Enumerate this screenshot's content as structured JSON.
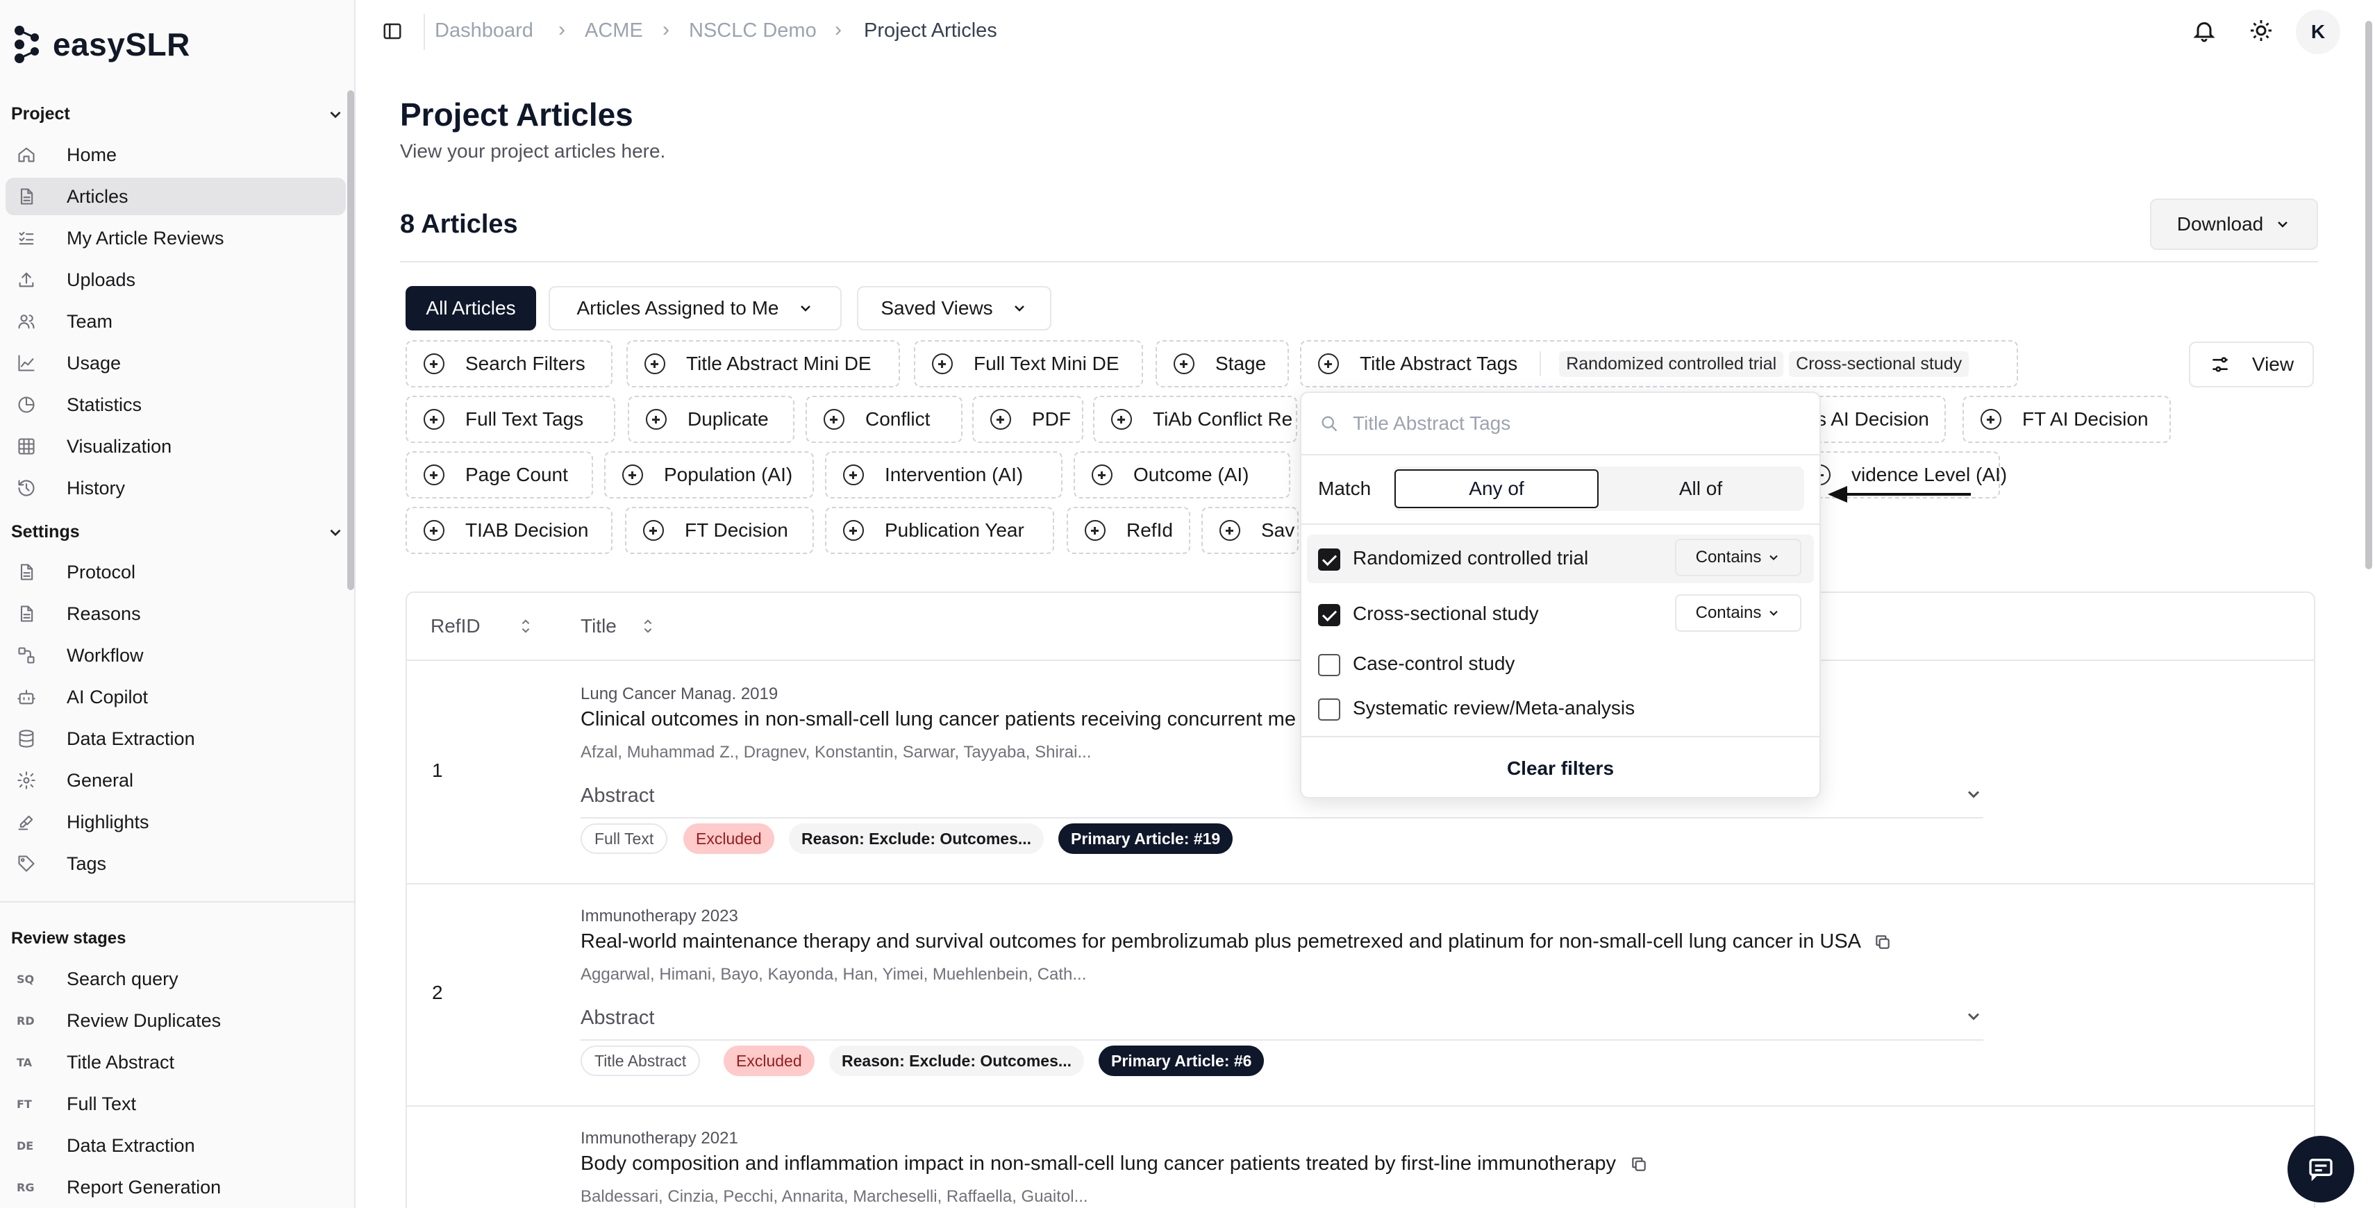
{
  "app": {
    "name": "easySLR"
  },
  "breadcrumb": [
    "Dashboard",
    "ACME",
    "NSCLC Demo",
    "Project Articles"
  ],
  "user": {
    "initial": "K"
  },
  "sidebar": {
    "project_label": "Project",
    "project_items": [
      {
        "label": "Home",
        "icon": "home-icon"
      },
      {
        "label": "Articles",
        "icon": "document-icon",
        "active": true
      },
      {
        "label": "My Article Reviews",
        "icon": "checklist-icon"
      },
      {
        "label": "Uploads",
        "icon": "upload-icon"
      },
      {
        "label": "Team",
        "icon": "team-icon"
      },
      {
        "label": "Usage",
        "icon": "usage-chart-icon"
      },
      {
        "label": "Statistics",
        "icon": "pie-chart-icon"
      },
      {
        "label": "Visualization",
        "icon": "grid-icon"
      },
      {
        "label": "History",
        "icon": "history-icon"
      }
    ],
    "settings_label": "Settings",
    "settings_items": [
      {
        "label": "Protocol",
        "icon": "document-icon"
      },
      {
        "label": "Reasons",
        "icon": "document-icon"
      },
      {
        "label": "Workflow",
        "icon": "workflow-icon"
      },
      {
        "label": "AI Copilot",
        "icon": "bot-icon"
      },
      {
        "label": "Data Extraction",
        "icon": "database-icon"
      },
      {
        "label": "General",
        "icon": "gear-icon"
      },
      {
        "label": "Highlights",
        "icon": "highlighter-icon"
      },
      {
        "label": "Tags",
        "icon": "tag-icon"
      }
    ],
    "review_label": "Review stages",
    "review_items": [
      {
        "code": "SQ",
        "label": "Search query"
      },
      {
        "code": "RD",
        "label": "Review Duplicates"
      },
      {
        "code": "TA",
        "label": "Title Abstract"
      },
      {
        "code": "FT",
        "label": "Full Text"
      },
      {
        "code": "DE",
        "label": "Data Extraction"
      },
      {
        "code": "RG",
        "label": "Report Generation"
      }
    ]
  },
  "main": {
    "title": "Project Articles",
    "subtitle": "View your project articles here.",
    "count_label": "8 Articles",
    "download_label": "Download",
    "view_label": "View",
    "tabs": [
      "All Articles",
      "Articles Assigned to Me",
      "Saved Views"
    ],
    "filters": {
      "row1": [
        "Search Filters",
        "Title Abstract Mini DE",
        "Full Text Mini DE",
        "Stage",
        "Title Abstract Tags"
      ],
      "active_tags": [
        "Randomized controlled trial",
        "Cross-sectional study"
      ],
      "row2": [
        "Full Text Tags",
        "Duplicate",
        "Conflict",
        "PDF",
        "TiAb Conflict Re",
        "s AI Decision",
        "FT AI Decision"
      ],
      "row3": [
        "Page Count",
        "Population (AI)",
        "Intervention (AI)",
        "Outcome (AI)",
        "vidence Level (AI)"
      ],
      "row4": [
        "TIAB Decision",
        "FT Decision",
        "Publication Year",
        "RefId",
        "Sav"
      ]
    },
    "table": {
      "col_refid": "RefID",
      "col_title": "Title",
      "abstract_label": "Abstract",
      "rows": [
        {
          "refid": "1",
          "journal": "Lung Cancer Manag. 2019",
          "title": "Clinical outcomes in non-small-cell lung cancer patients receiving concurrent me",
          "authors": "Afzal, Muhammad Z., Dragnev, Konstantin, Sarwar, Tayyaba, Shirai...",
          "stage": "Full Text",
          "status": "Excluded",
          "reason": "Reason: Exclude: Outcomes...",
          "primary": "Primary Article: #19"
        },
        {
          "refid": "2",
          "journal": "Immunotherapy 2023",
          "title": "Real-world maintenance therapy and survival outcomes for pembrolizumab plus pemetrexed and platinum for non-small-cell lung cancer in USA",
          "authors": "Aggarwal, Himani, Bayo, Kayonda, Han, Yimei, Muehlenbein, Cath...",
          "stage": "Title Abstract",
          "status": "Excluded",
          "reason": "Reason: Exclude: Outcomes...",
          "primary": "Primary Article: #6"
        },
        {
          "refid": "",
          "journal": "Immunotherapy 2021",
          "title": "Body composition and inflammation impact in non-small-cell lung cancer patients treated by first-line immunotherapy",
          "authors": "Baldessari, Cinzia, Pecchi, Annarita, Marcheselli, Raffaella, Guaitol...",
          "stage": "",
          "status": "",
          "reason": "",
          "primary": ""
        }
      ]
    }
  },
  "dropdown": {
    "search_placeholder": "Title Abstract Tags",
    "match_label": "Match",
    "any_label": "Any of",
    "all_label": "All of",
    "options": [
      {
        "label": "Randomized controlled trial",
        "checked": true,
        "mode": "Contains"
      },
      {
        "label": "Cross-sectional study",
        "checked": true,
        "mode": "Contains"
      },
      {
        "label": "Case-control study",
        "checked": false,
        "mode": ""
      },
      {
        "label": "Systematic review/Meta-analysis",
        "checked": false,
        "mode": ""
      }
    ],
    "clear_label": "Clear filters"
  }
}
